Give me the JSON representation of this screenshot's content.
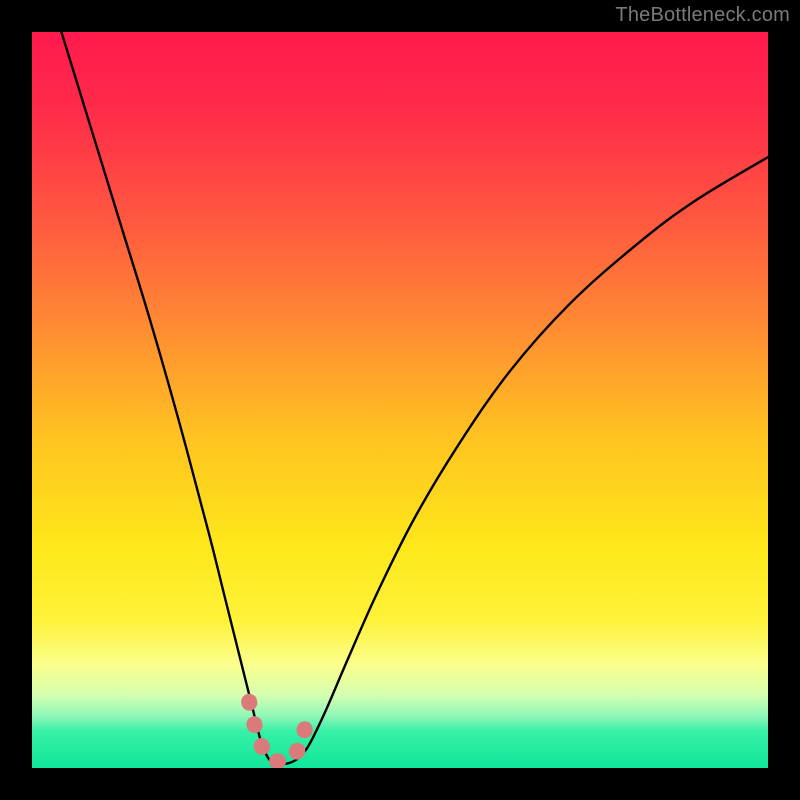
{
  "watermark": "TheBottleneck.com",
  "chart_data": {
    "type": "line",
    "title": "",
    "xlabel": "",
    "ylabel": "",
    "xlim": [
      0,
      100
    ],
    "ylim": [
      0,
      100
    ],
    "series": [
      {
        "name": "bottleneck-curve",
        "color": "#000000",
        "x": [
          4,
          8,
          12,
          16,
          20,
          24,
          26,
          28,
          30,
          31,
          32,
          33,
          34,
          35,
          36,
          37,
          38,
          40,
          43,
          47,
          52,
          58,
          65,
          73,
          82,
          90,
          100
        ],
        "y": [
          100,
          87,
          74,
          61,
          47,
          32,
          24,
          16,
          8,
          4,
          1.5,
          0.5,
          0.5,
          0.7,
          1.2,
          2.2,
          3.8,
          8,
          15,
          24,
          34,
          44,
          54,
          63,
          71,
          77,
          83
        ]
      }
    ],
    "highlight": {
      "name": "optimal-range-marker",
      "color": "#db7a7a",
      "x": [
        29.5,
        30.2,
        31.0,
        31.6,
        32.2,
        32.8,
        33.5,
        34.2,
        35.0,
        35.8,
        36.5,
        37.0,
        37.4
      ],
      "y": [
        9.0,
        6.0,
        3.5,
        2.2,
        1.4,
        1.0,
        0.9,
        1.0,
        1.3,
        2.0,
        3.2,
        5.0,
        7.5
      ]
    },
    "background_gradient": {
      "top": "#ff1a4d",
      "mid": "#fde81a",
      "bottom": "#10e59a"
    }
  }
}
